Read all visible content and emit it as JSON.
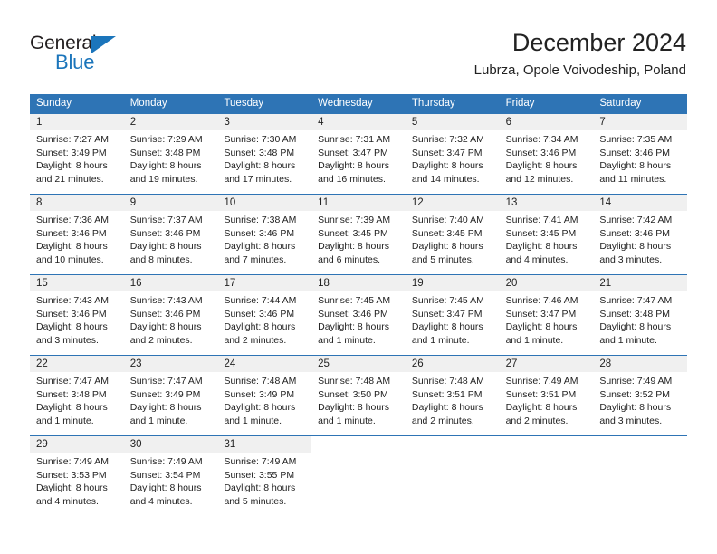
{
  "brand": {
    "name_top": "General",
    "name_bottom": "Blue",
    "accent_color": "#1b75bb",
    "triangle_icon": "brand-triangle-icon"
  },
  "header": {
    "title": "December 2024",
    "location": "Lubrza, Opole Voivodeship, Poland"
  },
  "theme": {
    "header_blue": "#2e74b5",
    "daynum_gray": "#f0f0f0",
    "text_color": "#222222"
  },
  "calendar": {
    "weekdays": [
      "Sunday",
      "Monday",
      "Tuesday",
      "Wednesday",
      "Thursday",
      "Friday",
      "Saturday"
    ],
    "weeks": [
      [
        {
          "day": "1",
          "sunrise": "Sunrise: 7:27 AM",
          "sunset": "Sunset: 3:49 PM",
          "daylight1": "Daylight: 8 hours",
          "daylight2": "and 21 minutes."
        },
        {
          "day": "2",
          "sunrise": "Sunrise: 7:29 AM",
          "sunset": "Sunset: 3:48 PM",
          "daylight1": "Daylight: 8 hours",
          "daylight2": "and 19 minutes."
        },
        {
          "day": "3",
          "sunrise": "Sunrise: 7:30 AM",
          "sunset": "Sunset: 3:48 PM",
          "daylight1": "Daylight: 8 hours",
          "daylight2": "and 17 minutes."
        },
        {
          "day": "4",
          "sunrise": "Sunrise: 7:31 AM",
          "sunset": "Sunset: 3:47 PM",
          "daylight1": "Daylight: 8 hours",
          "daylight2": "and 16 minutes."
        },
        {
          "day": "5",
          "sunrise": "Sunrise: 7:32 AM",
          "sunset": "Sunset: 3:47 PM",
          "daylight1": "Daylight: 8 hours",
          "daylight2": "and 14 minutes."
        },
        {
          "day": "6",
          "sunrise": "Sunrise: 7:34 AM",
          "sunset": "Sunset: 3:46 PM",
          "daylight1": "Daylight: 8 hours",
          "daylight2": "and 12 minutes."
        },
        {
          "day": "7",
          "sunrise": "Sunrise: 7:35 AM",
          "sunset": "Sunset: 3:46 PM",
          "daylight1": "Daylight: 8 hours",
          "daylight2": "and 11 minutes."
        }
      ],
      [
        {
          "day": "8",
          "sunrise": "Sunrise: 7:36 AM",
          "sunset": "Sunset: 3:46 PM",
          "daylight1": "Daylight: 8 hours",
          "daylight2": "and 10 minutes."
        },
        {
          "day": "9",
          "sunrise": "Sunrise: 7:37 AM",
          "sunset": "Sunset: 3:46 PM",
          "daylight1": "Daylight: 8 hours",
          "daylight2": "and 8 minutes."
        },
        {
          "day": "10",
          "sunrise": "Sunrise: 7:38 AM",
          "sunset": "Sunset: 3:46 PM",
          "daylight1": "Daylight: 8 hours",
          "daylight2": "and 7 minutes."
        },
        {
          "day": "11",
          "sunrise": "Sunrise: 7:39 AM",
          "sunset": "Sunset: 3:45 PM",
          "daylight1": "Daylight: 8 hours",
          "daylight2": "and 6 minutes."
        },
        {
          "day": "12",
          "sunrise": "Sunrise: 7:40 AM",
          "sunset": "Sunset: 3:45 PM",
          "daylight1": "Daylight: 8 hours",
          "daylight2": "and 5 minutes."
        },
        {
          "day": "13",
          "sunrise": "Sunrise: 7:41 AM",
          "sunset": "Sunset: 3:45 PM",
          "daylight1": "Daylight: 8 hours",
          "daylight2": "and 4 minutes."
        },
        {
          "day": "14",
          "sunrise": "Sunrise: 7:42 AM",
          "sunset": "Sunset: 3:46 PM",
          "daylight1": "Daylight: 8 hours",
          "daylight2": "and 3 minutes."
        }
      ],
      [
        {
          "day": "15",
          "sunrise": "Sunrise: 7:43 AM",
          "sunset": "Sunset: 3:46 PM",
          "daylight1": "Daylight: 8 hours",
          "daylight2": "and 3 minutes."
        },
        {
          "day": "16",
          "sunrise": "Sunrise: 7:43 AM",
          "sunset": "Sunset: 3:46 PM",
          "daylight1": "Daylight: 8 hours",
          "daylight2": "and 2 minutes."
        },
        {
          "day": "17",
          "sunrise": "Sunrise: 7:44 AM",
          "sunset": "Sunset: 3:46 PM",
          "daylight1": "Daylight: 8 hours",
          "daylight2": "and 2 minutes."
        },
        {
          "day": "18",
          "sunrise": "Sunrise: 7:45 AM",
          "sunset": "Sunset: 3:46 PM",
          "daylight1": "Daylight: 8 hours",
          "daylight2": "and 1 minute."
        },
        {
          "day": "19",
          "sunrise": "Sunrise: 7:45 AM",
          "sunset": "Sunset: 3:47 PM",
          "daylight1": "Daylight: 8 hours",
          "daylight2": "and 1 minute."
        },
        {
          "day": "20",
          "sunrise": "Sunrise: 7:46 AM",
          "sunset": "Sunset: 3:47 PM",
          "daylight1": "Daylight: 8 hours",
          "daylight2": "and 1 minute."
        },
        {
          "day": "21",
          "sunrise": "Sunrise: 7:47 AM",
          "sunset": "Sunset: 3:48 PM",
          "daylight1": "Daylight: 8 hours",
          "daylight2": "and 1 minute."
        }
      ],
      [
        {
          "day": "22",
          "sunrise": "Sunrise: 7:47 AM",
          "sunset": "Sunset: 3:48 PM",
          "daylight1": "Daylight: 8 hours",
          "daylight2": "and 1 minute."
        },
        {
          "day": "23",
          "sunrise": "Sunrise: 7:47 AM",
          "sunset": "Sunset: 3:49 PM",
          "daylight1": "Daylight: 8 hours",
          "daylight2": "and 1 minute."
        },
        {
          "day": "24",
          "sunrise": "Sunrise: 7:48 AM",
          "sunset": "Sunset: 3:49 PM",
          "daylight1": "Daylight: 8 hours",
          "daylight2": "and 1 minute."
        },
        {
          "day": "25",
          "sunrise": "Sunrise: 7:48 AM",
          "sunset": "Sunset: 3:50 PM",
          "daylight1": "Daylight: 8 hours",
          "daylight2": "and 1 minute."
        },
        {
          "day": "26",
          "sunrise": "Sunrise: 7:48 AM",
          "sunset": "Sunset: 3:51 PM",
          "daylight1": "Daylight: 8 hours",
          "daylight2": "and 2 minutes."
        },
        {
          "day": "27",
          "sunrise": "Sunrise: 7:49 AM",
          "sunset": "Sunset: 3:51 PM",
          "daylight1": "Daylight: 8 hours",
          "daylight2": "and 2 minutes."
        },
        {
          "day": "28",
          "sunrise": "Sunrise: 7:49 AM",
          "sunset": "Sunset: 3:52 PM",
          "daylight1": "Daylight: 8 hours",
          "daylight2": "and 3 minutes."
        }
      ],
      [
        {
          "day": "29",
          "sunrise": "Sunrise: 7:49 AM",
          "sunset": "Sunset: 3:53 PM",
          "daylight1": "Daylight: 8 hours",
          "daylight2": "and 4 minutes."
        },
        {
          "day": "30",
          "sunrise": "Sunrise: 7:49 AM",
          "sunset": "Sunset: 3:54 PM",
          "daylight1": "Daylight: 8 hours",
          "daylight2": "and 4 minutes."
        },
        {
          "day": "31",
          "sunrise": "Sunrise: 7:49 AM",
          "sunset": "Sunset: 3:55 PM",
          "daylight1": "Daylight: 8 hours",
          "daylight2": "and 5 minutes."
        },
        {
          "day": "",
          "sunrise": "",
          "sunset": "",
          "daylight1": "",
          "daylight2": ""
        },
        {
          "day": "",
          "sunrise": "",
          "sunset": "",
          "daylight1": "",
          "daylight2": ""
        },
        {
          "day": "",
          "sunrise": "",
          "sunset": "",
          "daylight1": "",
          "daylight2": ""
        },
        {
          "day": "",
          "sunrise": "",
          "sunset": "",
          "daylight1": "",
          "daylight2": ""
        }
      ]
    ]
  }
}
